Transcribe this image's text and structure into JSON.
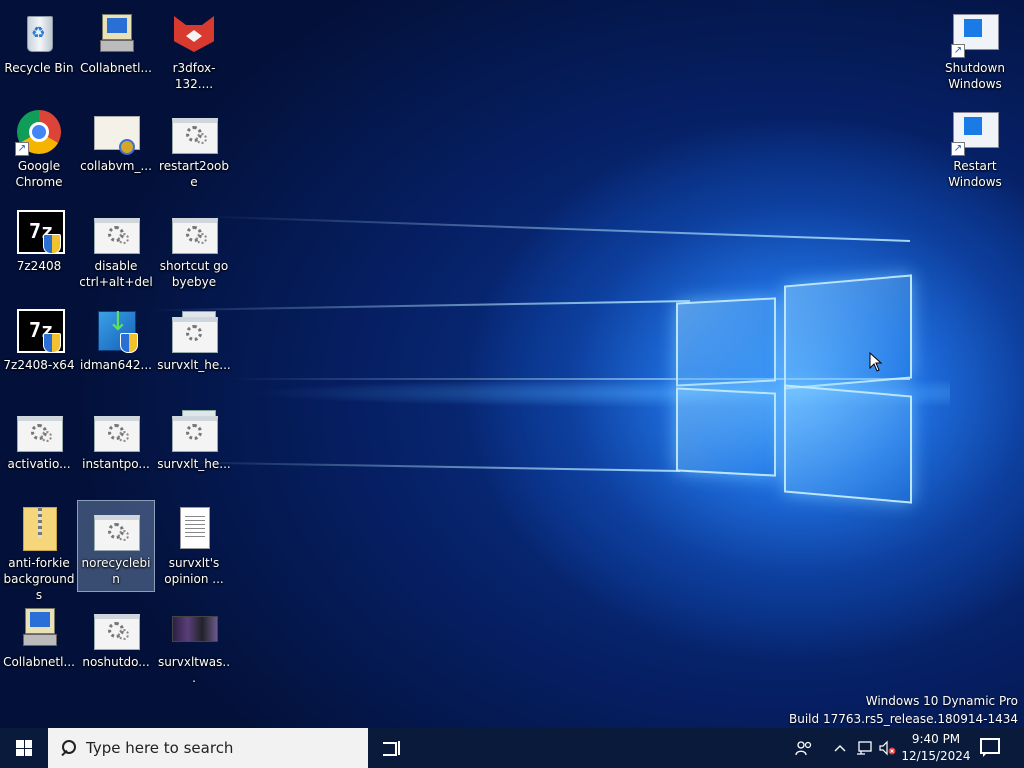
{
  "desktop": {
    "icons": {
      "recycle_bin": "Recycle Bin",
      "collabnet1": "Collabnetl...",
      "r3dfox": "r3dfox-132....",
      "shutdown": "Shutdown Windows",
      "chrome": "Google Chrome",
      "collabvm": "collabvm_...",
      "restart2oobe": "restart2oobe",
      "restart": "Restart Windows",
      "z7_2408": "7z2408",
      "disable_cad": "disable ctrl+alt+del",
      "shortcut_gobyebye": "shortcut go byebye",
      "z7_2408_x64": "7z2408-x64",
      "idman": "idman642...",
      "survxlt_he1": "survxlt_he...",
      "activation": "activatio...",
      "instantpo": "instantpo...",
      "survxlt_he2": "survxlt_he...",
      "antiforkie": "anti-forkie backgrounds",
      "norecyclebin": "norecyclebi n",
      "survxlt_opinion": "survxlt's opinion ...",
      "collabnet2": "Collabnetl...",
      "noshutdo": "noshutdo...",
      "survxltwas": "survxltwas..."
    },
    "watermark": {
      "line1": "Windows 10 Dynamic Pro",
      "line2": "Build 17763.rs5_release.180914-1434"
    }
  },
  "taskbar": {
    "search_placeholder": "Type here to search",
    "time": "9:40 PM",
    "date": "12/15/2024"
  },
  "colors": {
    "taskbar": "#0a1a3a",
    "desktop_accent": "#1f6fe0"
  }
}
